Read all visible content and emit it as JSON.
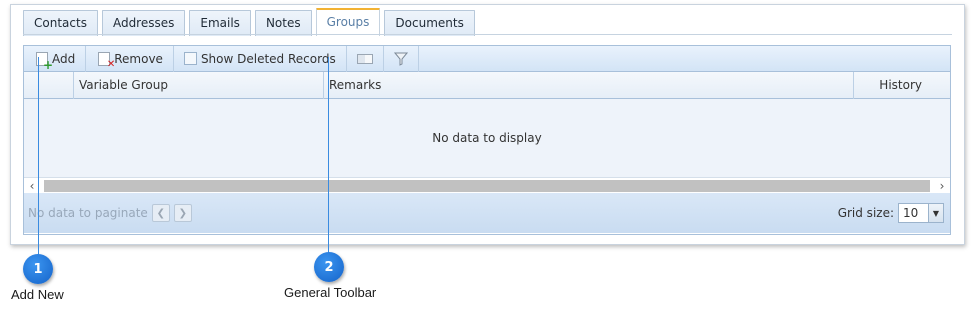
{
  "tabs": [
    {
      "label": "Contacts",
      "active": false
    },
    {
      "label": "Addresses",
      "active": false
    },
    {
      "label": "Emails",
      "active": false
    },
    {
      "label": "Notes",
      "active": false
    },
    {
      "label": "Groups",
      "active": true
    },
    {
      "label": "Documents",
      "active": false
    }
  ],
  "toolbar": {
    "add_label": "Add",
    "remove_label": "Remove",
    "show_deleted_label": "Show Deleted Records",
    "show_deleted_checked": false
  },
  "columns": [
    "Variable Group",
    "Remarks",
    "History"
  ],
  "grid": {
    "empty_message": "No data to display"
  },
  "pager": {
    "no_data_label": "No data to paginate",
    "grid_size_label": "Grid size:",
    "grid_size_value": "10"
  },
  "callouts": [
    {
      "number": "1",
      "label": "Add New"
    },
    {
      "number": "2",
      "label": "General Toolbar"
    }
  ],
  "colors": {
    "active_tab_accent": "#f2b233",
    "callout_badge": "#1f77d8"
  }
}
